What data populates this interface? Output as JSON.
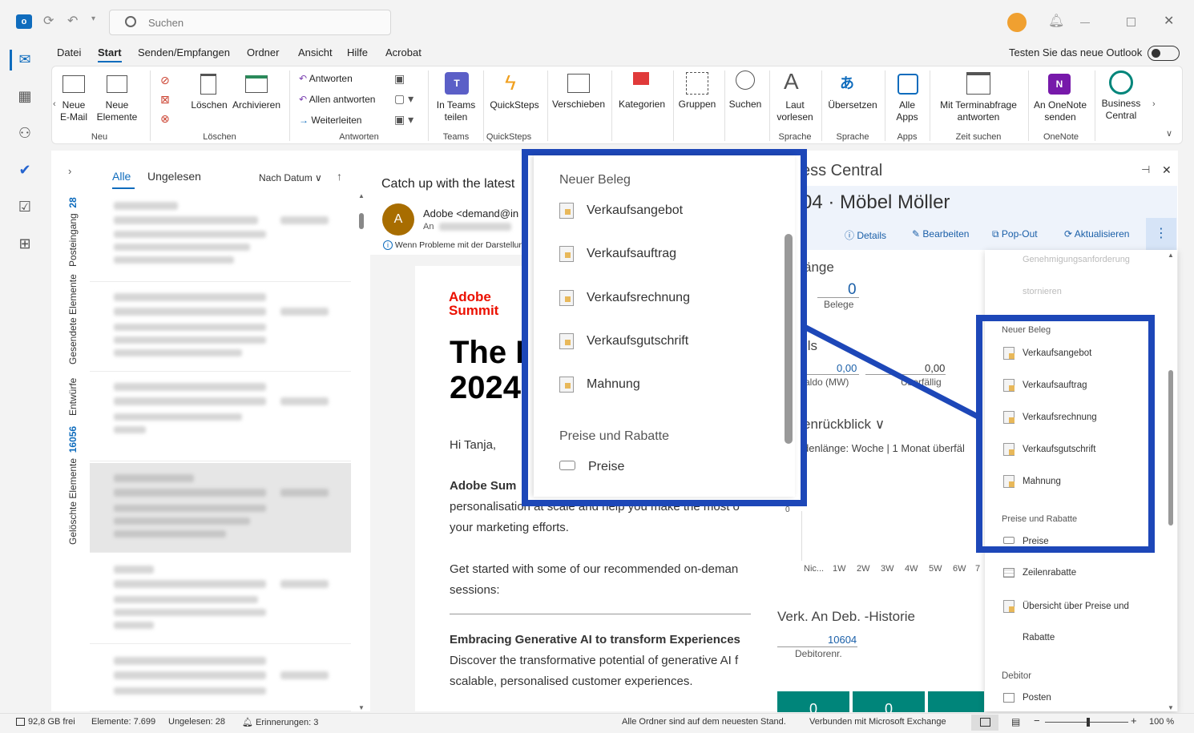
{
  "app": {
    "search_placeholder": "Suchen",
    "try_new": "Testen Sie das neue Outlook"
  },
  "menu": [
    "Datei",
    "Start",
    "Senden/Empfangen",
    "Ordner",
    "Ansicht",
    "Hilfe",
    "Acrobat"
  ],
  "ribbon": {
    "new_mail": "Neue\nE-Mail",
    "new_items": "Neue\nElemente",
    "group_new": "Neu",
    "delete": "Löschen",
    "archive": "Archivieren",
    "group_delete": "Löschen",
    "reply": "Antworten",
    "reply_all": "Allen antworten",
    "forward": "Weiterleiten",
    "group_reply": "Antworten",
    "teams_share": "In Teams\nteilen",
    "group_teams": "Teams",
    "quicksteps": "QuickSteps",
    "group_quicksteps": "QuickSteps",
    "move": "Verschieben",
    "categories": "Kategorien",
    "groups": "Gruppen",
    "search": "Suchen",
    "read_aloud": "Laut\nvorlesen",
    "group_speech": "Sprache",
    "translate": "Übersetzen",
    "group_speech2": "Sprache",
    "all_apps": "Alle\nApps",
    "group_apps": "Apps",
    "meeting_reply": "Mit Terminabfrage\nantworten",
    "group_time": "Zeit suchen",
    "onenote": "An OneNote\nsenden",
    "group_onenote": "OneNote",
    "bc": "Business\nCentral"
  },
  "folders": [
    "Posteingang",
    "28",
    "Gesendete Elemente",
    "Entwürfe",
    "16056",
    "Gelöschte Elemente"
  ],
  "list": {
    "tab_all": "Alle",
    "tab_unread": "Ungelesen",
    "sort": "Nach Datum"
  },
  "reading": {
    "subject": "Catch up with the latest",
    "sender": "Adobe <demand@in",
    "to": "An",
    "info": "Wenn Probleme mit der Darstellung",
    "avatar": "A",
    "logo1": "Adobe",
    "logo2": "Summit",
    "headline1": "The I",
    "headline2": "2024",
    "greeting": "Hi Tanja,",
    "p1b": "Adobe Sum",
    "p1": "personalisation at scale and help you make the most o",
    "p1c": "your marketing efforts.",
    "p2": "Get started with some of our recommended on-deman",
    "p2c": "sessions:",
    "h2": "Embracing Generative AI to transform Experiences",
    "p3": "Discover the transformative potential of generative AI f",
    "p3c": "scalable, personalised customer experiences."
  },
  "bc": {
    "title": "ess Central",
    "record": "04 · Möbel Möller",
    "details": "Details",
    "edit": "Bearbeiten",
    "popout": "Pop-Out",
    "refresh": "Aktualisieren",
    "cue_head": "änge",
    "cue_val": "0",
    "cue_lbl": "Belege",
    "fin": "ils",
    "bal_val": "0,00",
    "bal_lbl": "aldo (MW)",
    "due_val": "0,00",
    "due_lbl": "Überfällig",
    "review": "enrückblick",
    "period": "denlänge: Woche | 1 Monat überfäl",
    "axis0": "0",
    "ticks": [
      "Nic...",
      "1W",
      "2W",
      "3W",
      "4W",
      "5W",
      "6W",
      "7"
    ],
    "hist": "Verk. An Deb. -Historie",
    "hist_val": "10604",
    "hist_lbl": "Debitorenr.",
    "tile1": "0",
    "tile2": "0"
  },
  "small_menu": {
    "faded1": "Genehmigungsanforderung",
    "faded2": "stornieren",
    "section1": "Neuer Beleg",
    "items1": [
      "Verkaufsangebot",
      "Verkaufsauftrag",
      "Verkaufsrechnung",
      "Verkaufsgutschrift",
      "Mahnung"
    ],
    "section2": "Preise und Rabatte",
    "items2": [
      "Preise",
      "Zeilenrabatte",
      "Übersicht über Preise und",
      "Rabatte"
    ],
    "section3": "Debitor",
    "items3": [
      "Posten"
    ]
  },
  "zoom_menu": {
    "section1": "Neuer Beleg",
    "items1": [
      "Verkaufsangebot",
      "Verkaufsauftrag",
      "Verkaufsrechnung",
      "Verkaufsgutschrift",
      "Mahnung"
    ],
    "section2": "Preise und Rabatte",
    "items2": [
      "Preise"
    ]
  },
  "status": {
    "disk": "92,8 GB frei",
    "items": "Elemente: 7.699",
    "unread": "Ungelesen: 28",
    "reminders": "Erinnerungen: 3",
    "sync": "Alle Ordner sind auf dem neuesten Stand.",
    "conn": "Verbunden mit Microsoft Exchange",
    "zoom": "100 %"
  },
  "colors": {
    "accent": "#0f6cbd",
    "highlight": "#1d47b8",
    "teal": "#00857a",
    "red": "#eb1000"
  }
}
